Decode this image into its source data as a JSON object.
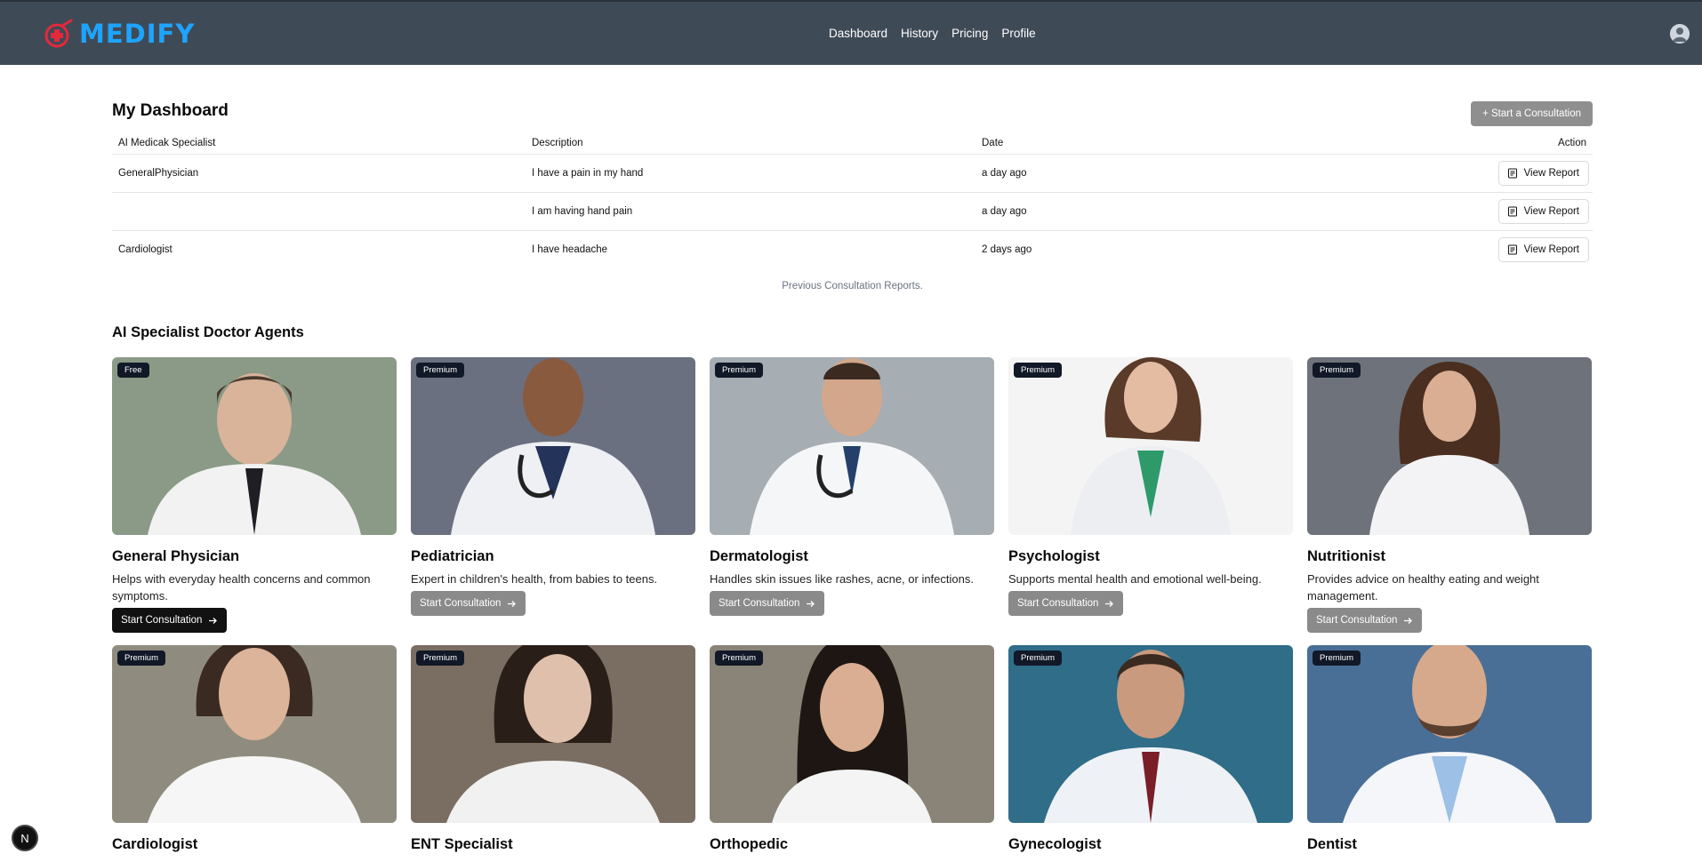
{
  "brand": {
    "name": "MEDIFY"
  },
  "nav": [
    {
      "label": "Dashboard"
    },
    {
      "label": "History"
    },
    {
      "label": "Pricing"
    },
    {
      "label": "Profile"
    }
  ],
  "dashboard": {
    "title": "My Dashboard",
    "start_button": "+ Start a Consultation",
    "columns": [
      "AI Medicak Specialist",
      "Description",
      "Date",
      "Action"
    ],
    "rows": [
      {
        "specialist": "GeneralPhysician",
        "description": "I have a pain in my hand",
        "date": "a day ago",
        "action": "View Report"
      },
      {
        "specialist": "",
        "description": "I am having hand pain",
        "date": "a day ago",
        "action": "View Report"
      },
      {
        "specialist": "Cardiologist",
        "description": "I have headache",
        "date": "2 days ago",
        "action": "View Report"
      }
    ],
    "caption": "Previous Consultation Reports."
  },
  "agents": {
    "title": "AI Specialist Doctor Agents",
    "button_label": "Start Consultation",
    "items": [
      {
        "badge": "Free",
        "name": "General Physician",
        "description": "Helps with everyday health concerns and common symptoms.",
        "bg": "#8a9a86"
      },
      {
        "badge": "Premium",
        "name": "Pediatrician",
        "description": "Expert in children's health, from babies to teens.",
        "bg": "#6a7080"
      },
      {
        "badge": "Premium",
        "name": "Dermatologist",
        "description": "Handles skin issues like rashes, acne, or infections.",
        "bg": "#a6adb3"
      },
      {
        "badge": "Premium",
        "name": "Psychologist",
        "description": "Supports mental health and emotional well-being.",
        "bg": "#f4f4f4"
      },
      {
        "badge": "Premium",
        "name": "Nutritionist",
        "description": "Provides advice on healthy eating and weight management.",
        "bg": "#6e737b"
      },
      {
        "badge": "Premium",
        "name": "Cardiologist",
        "description": "",
        "bg": "#8f8c7f"
      },
      {
        "badge": "Premium",
        "name": "ENT Specialist",
        "description": "",
        "bg": "#7a6d62"
      },
      {
        "badge": "Premium",
        "name": "Orthopedic",
        "description": "",
        "bg": "#8a8478"
      },
      {
        "badge": "Premium",
        "name": "Gynecologist",
        "description": "",
        "bg": "#2f6d88"
      },
      {
        "badge": "Premium",
        "name": "Dentist",
        "description": "",
        "bg": "#4a6f96"
      }
    ]
  },
  "floating_badge": {
    "label": "N"
  },
  "colors": {
    "header": "#3f4a57",
    "logo": "#1ea4ff",
    "logo_mark": "#e5283a",
    "active_button": "#111111",
    "disabled_button": "#8a8a8a"
  }
}
